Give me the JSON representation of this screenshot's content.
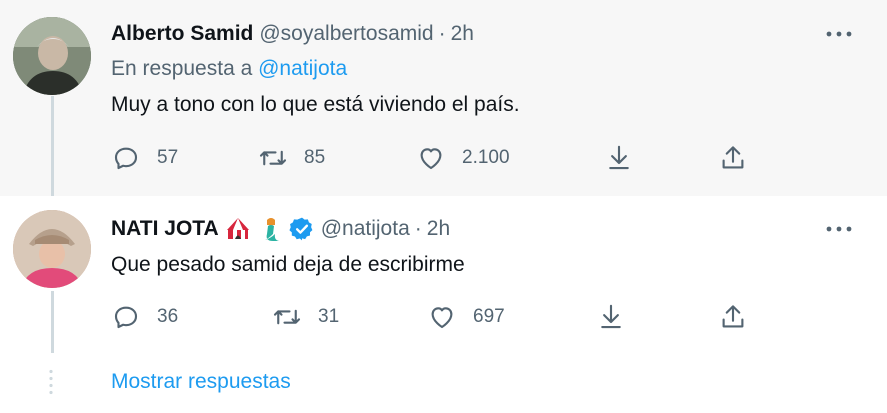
{
  "tweets": [
    {
      "name": "Alberto Samid",
      "handle": "@soyalbertosamid",
      "separator": "·",
      "time": "2h",
      "reply_prefix": "En respuesta a",
      "reply_to": "@natijota",
      "text": "Muy a tono con lo que está viviendo el país.",
      "replies": "57",
      "retweets": "85",
      "likes": "2.100"
    },
    {
      "name": "NATI JOTA",
      "emojis": [
        "circus-tent-icon",
        "mermaid-icon"
      ],
      "verified": true,
      "handle": "@natijota",
      "separator": "·",
      "time": "2h",
      "text": "Que pesado samid deja de escribirme",
      "replies": "36",
      "retweets": "31",
      "likes": "697"
    }
  ],
  "show_replies": "Mostrar respuestas",
  "colors": {
    "accent": "#1d9bf0",
    "muted": "#536471",
    "text": "#0f1419",
    "thread_line": "#cfd9de"
  }
}
